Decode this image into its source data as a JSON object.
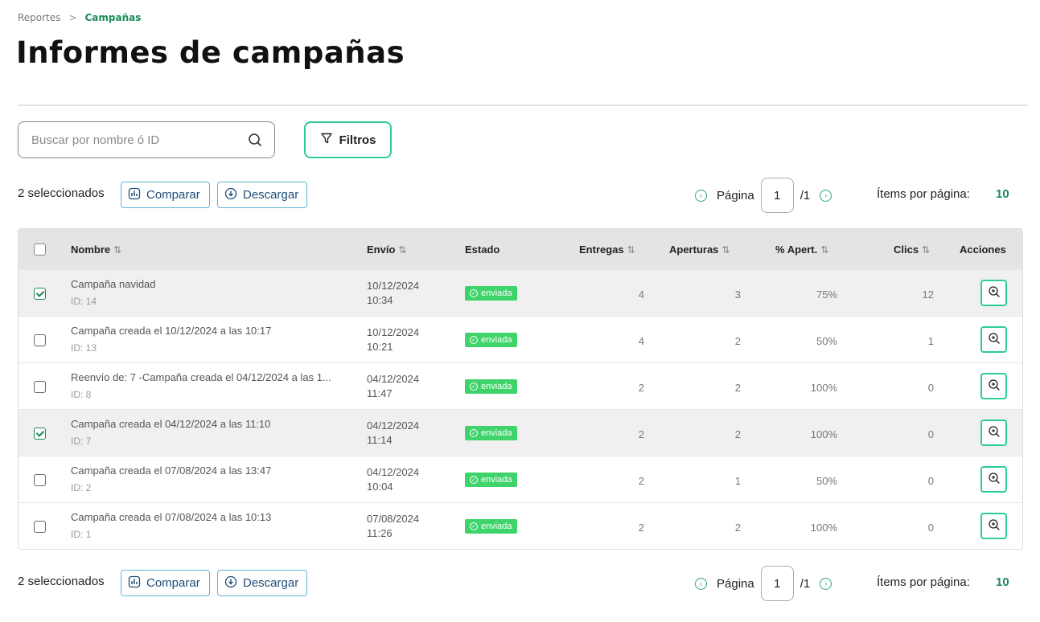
{
  "breadcrumb": {
    "parent": "Reportes",
    "separator": ">",
    "current": "Campañas"
  },
  "page_title": "Informes de campañas",
  "search": {
    "placeholder": "Buscar por nombre ó ID",
    "value": ""
  },
  "filters_button": "Filtros",
  "selection": {
    "count_label": "2 seleccionados",
    "compare_label": "Comparar",
    "download_label": "Descargar"
  },
  "pagination": {
    "page_label": "Página",
    "current_page": "1",
    "total_label": "/1",
    "items_per_page_label": "Ítems por página:",
    "items_per_page": "10"
  },
  "table": {
    "columns": {
      "nombre": "Nombre",
      "envio": "Envío",
      "estado": "Estado",
      "entregas": "Entregas",
      "aperturas": "Aperturas",
      "pct_apert": "% Apert.",
      "clics": "Clics",
      "acciones": "Acciones"
    },
    "rows": [
      {
        "selected": true,
        "name": "Campaña navidad",
        "id": "ID: 14",
        "date": "10/12/2024",
        "time": "10:34",
        "status": "enviada",
        "entregas": "4",
        "aperturas": "3",
        "pct": "75%",
        "clics": "12"
      },
      {
        "selected": false,
        "name": "Campaña creada el 10/12/2024 a las 10:17",
        "id": "ID: 13",
        "date": "10/12/2024",
        "time": "10:21",
        "status": "enviada",
        "entregas": "4",
        "aperturas": "2",
        "pct": "50%",
        "clics": "1"
      },
      {
        "selected": false,
        "name": "Reenvío de: 7 -Campaña creada el 04/12/2024 a las 1...",
        "id": "ID: 8",
        "date": "04/12/2024",
        "time": "11:47",
        "status": "enviada",
        "entregas": "2",
        "aperturas": "2",
        "pct": "100%",
        "clics": "0"
      },
      {
        "selected": true,
        "name": "Campaña creada el 04/12/2024 a las 11:10",
        "id": "ID: 7",
        "date": "04/12/2024",
        "time": "11:14",
        "status": "enviada",
        "entregas": "2",
        "aperturas": "2",
        "pct": "100%",
        "clics": "0"
      },
      {
        "selected": false,
        "name": "Campaña creada el 07/08/2024 a las 13:47",
        "id": "ID: 2",
        "date": "04/12/2024",
        "time": "10:04",
        "status": "enviada",
        "entregas": "2",
        "aperturas": "1",
        "pct": "50%",
        "clics": "0"
      },
      {
        "selected": false,
        "name": "Campaña creada el 07/08/2024 a las 10:13",
        "id": "ID: 1",
        "date": "07/08/2024",
        "time": "11:26",
        "status": "enviada",
        "entregas": "2",
        "aperturas": "2",
        "pct": "100%",
        "clics": "0"
      }
    ]
  },
  "icons": {
    "search": "search-icon",
    "filter": "filter-icon",
    "compare": "chart-icon",
    "download": "download-icon",
    "prev": "chevron-left-circle-icon",
    "next": "chevron-right-circle-icon",
    "sort": "sort-icon",
    "status": "check-circle-icon",
    "view": "zoom-in-icon"
  },
  "colors": {
    "accent": "#2ecc9a",
    "brand_green": "#1b8a5a",
    "badge_green": "#3fd46b",
    "button_blue": "#5fb3d9"
  }
}
